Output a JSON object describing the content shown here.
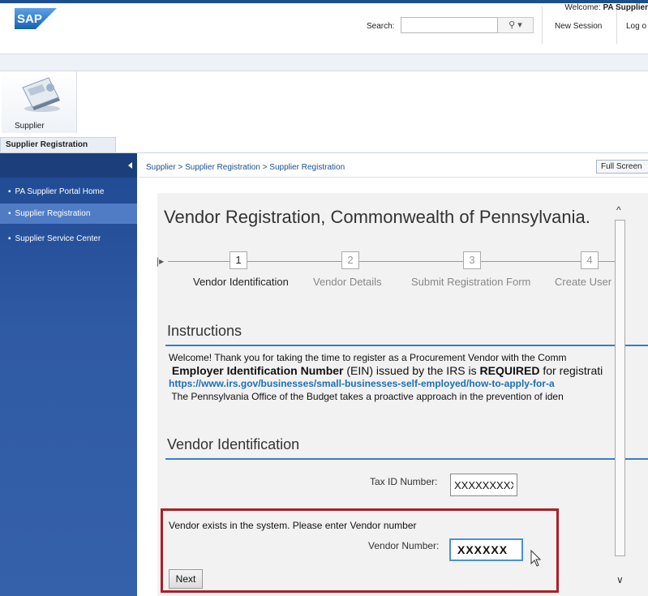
{
  "header": {
    "logo_text": "SAP",
    "search_label": "Search:",
    "search_value": "",
    "search_button": "⚲ ▾",
    "new_session": "New Session",
    "logoff": "Log o"
  },
  "welcome": {
    "prefix": "Welcome: ",
    "name": "PA Supplier"
  },
  "role": {
    "label": "Supplier"
  },
  "subtab": {
    "label": "Supplier Registration"
  },
  "nav": {
    "items": [
      {
        "label": "PA Supplier Portal Home",
        "active": false
      },
      {
        "label": "Supplier Registration",
        "active": true
      },
      {
        "label": "Supplier Service Center",
        "active": false
      }
    ]
  },
  "breadcrumb": {
    "text": "Supplier  >  Supplier Registration  >  Supplier Registration",
    "full_screen": "Full Screen"
  },
  "main": {
    "title": "Vendor Registration, Commonwealth of Pennsylvania.",
    "steps": [
      {
        "number": "1",
        "label": "Vendor Identification",
        "active": true
      },
      {
        "number": "2",
        "label": "Vendor Details",
        "active": false
      },
      {
        "number": "3",
        "label": "Submit Registration Form",
        "active": false
      },
      {
        "number": "4",
        "label": "Create User",
        "active": false
      }
    ],
    "instructions_title": "Instructions",
    "instructions": {
      "line1": "Welcome! Thank you for taking the time to register as a Procurement Vendor with the Comm",
      "line2_bold": "Employer Identification Number",
      "line2_mid": " (EIN) issued by the IRS is ",
      "line2_req": "REQUIRED",
      "line2_end": " for registrati",
      "line3_link": "https://www.irs.gov/businesses/small-businesses-self-employed/how-to-apply-for-a",
      "line4": "The Pennsylvania Office of the Budget takes a proactive approach in the prevention of iden"
    },
    "vendor_id_title": "Vendor Identification",
    "tax_id_label": "Tax ID Number:",
    "tax_id_value": "XXXXXXXXX",
    "vendor_exists_msg": "Vendor exists in the system. Please enter Vendor number",
    "vendor_number_label": "Vendor Number:",
    "vendor_number_value": "XXXXXX",
    "next_button": "Next"
  },
  "colors": {
    "nav_bg": "#2f5aa4",
    "highlight_border": "#b01e24",
    "section_rule": "#3a7cc5"
  }
}
